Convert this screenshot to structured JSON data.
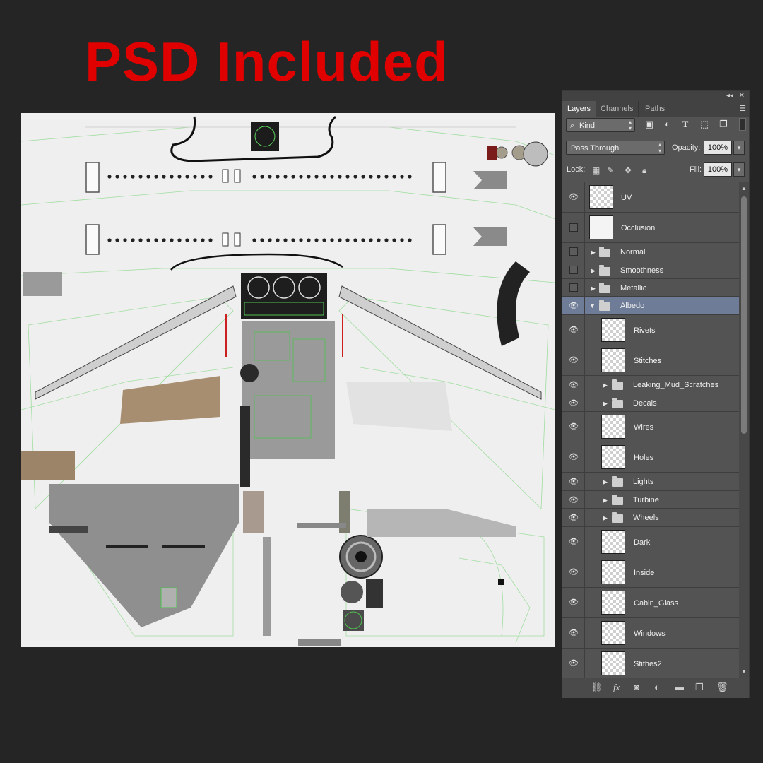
{
  "headline": "PSD Included",
  "panel": {
    "tabs": [
      "Layers",
      "Channels",
      "Paths"
    ],
    "filter_kind": "Kind",
    "blend_mode": "Pass Through",
    "opacity_label": "Opacity:",
    "opacity_value": "100%",
    "lock_label": "Lock:",
    "fill_label": "Fill:",
    "fill_value": "100%",
    "layers": [
      {
        "name": "UV",
        "type": "layer",
        "visible": true
      },
      {
        "name": "Occlusion",
        "type": "layer",
        "visible": false
      },
      {
        "name": "Normal",
        "type": "group",
        "visible": false,
        "expanded": false
      },
      {
        "name": "Smoothness",
        "type": "group",
        "visible": false,
        "expanded": false
      },
      {
        "name": "Metallic",
        "type": "group",
        "visible": false,
        "expanded": false
      },
      {
        "name": "Albedo",
        "type": "group",
        "visible": true,
        "expanded": true,
        "selected": true
      },
      {
        "name": "Rivets",
        "type": "layer",
        "visible": true,
        "nested": true
      },
      {
        "name": "Stitches",
        "type": "layer",
        "visible": true,
        "nested": true
      },
      {
        "name": "Leaking_Mud_Scratches",
        "type": "group",
        "visible": true,
        "nested": true
      },
      {
        "name": "Decals",
        "type": "group",
        "visible": true,
        "nested": true
      },
      {
        "name": "Wires",
        "type": "layer",
        "visible": true,
        "nested": true
      },
      {
        "name": "Holes",
        "type": "layer",
        "visible": true,
        "nested": true
      },
      {
        "name": "Lights",
        "type": "group",
        "visible": true,
        "nested": true
      },
      {
        "name": "Turbine",
        "type": "group",
        "visible": true,
        "nested": true
      },
      {
        "name": "Wheels",
        "type": "group",
        "visible": true,
        "nested": true
      },
      {
        "name": "Dark",
        "type": "layer",
        "visible": true,
        "nested": true
      },
      {
        "name": "Inside",
        "type": "layer",
        "visible": true,
        "nested": true
      },
      {
        "name": "Cabin_Glass",
        "type": "layer",
        "visible": true,
        "nested": true
      },
      {
        "name": "Windows",
        "type": "layer",
        "visible": true,
        "nested": true
      },
      {
        "name": "Stithes2",
        "type": "layer",
        "visible": true,
        "nested": true
      }
    ],
    "bottom_icons": [
      "link-icon",
      "fx-icon",
      "mask-icon",
      "adjustment-icon",
      "folder-icon",
      "new-layer-icon",
      "trash-icon"
    ]
  },
  "colors": {
    "headline": "#e00000",
    "background": "#252525",
    "panel": "#535353",
    "selection": "#6e7c98"
  }
}
